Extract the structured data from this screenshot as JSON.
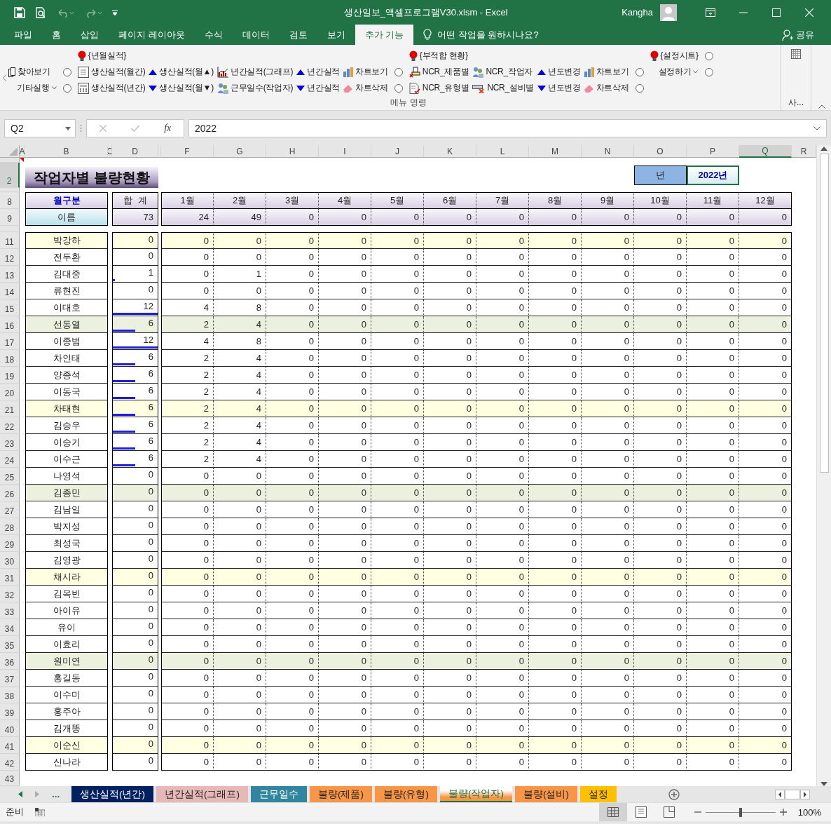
{
  "window": {
    "title": "생산일보_액셀프로그램V30.xlsm  -  Excel",
    "user": "Kangha"
  },
  "menu_tabs": [
    {
      "label": "파일",
      "selected": false
    },
    {
      "label": "홈",
      "selected": false
    },
    {
      "label": "삽입",
      "selected": false
    },
    {
      "label": "페이지 레이아웃",
      "selected": false
    },
    {
      "label": "수식",
      "selected": false
    },
    {
      "label": "데이터",
      "selected": false
    },
    {
      "label": "검토",
      "selected": false
    },
    {
      "label": "보기",
      "selected": false
    },
    {
      "label": "추가 기능",
      "selected": true
    }
  ],
  "tell_me": "어떤 작업을 원하시나요?",
  "share": "공유",
  "ribbon": {
    "columns": [
      {
        "cells": [
          {
            "kind": "blank"
          },
          {
            "kind": "find",
            "label": "찾아보기"
          },
          {
            "kind": "menu",
            "label": "기타실행"
          }
        ]
      },
      {
        "cells": [
          {
            "kind": "blank"
          },
          {
            "kind": "radio",
            "selected": false
          },
          {
            "kind": "radio",
            "selected": false
          }
        ]
      },
      {
        "cells": [
          {
            "kind": "heading",
            "label": "{년월실적}"
          },
          {
            "kind": "form",
            "label": "생산실적(월간)"
          },
          {
            "kind": "calc",
            "label": "생산실적(년간)"
          }
        ]
      },
      {
        "cells": [
          {
            "kind": "blank"
          },
          {
            "kind": "up",
            "label": "생산실적(월▲)"
          },
          {
            "kind": "down",
            "label": "생산실적(월▼)"
          }
        ]
      },
      {
        "cells": [
          {
            "kind": "blank"
          },
          {
            "kind": "graph",
            "label": "년간실적(그래프)"
          },
          {
            "kind": "people",
            "label": "근무일수(작업자)"
          }
        ]
      },
      {
        "cells": [
          {
            "kind": "blank"
          },
          {
            "kind": "up",
            "label": "년간실적"
          },
          {
            "kind": "down",
            "label": "년간실적"
          }
        ]
      },
      {
        "cells": [
          {
            "kind": "blank"
          },
          {
            "kind": "chart",
            "label": "차트보기"
          },
          {
            "kind": "eraser",
            "label": "차트삭제"
          }
        ]
      },
      {
        "cells": [
          {
            "kind": "blank"
          },
          {
            "kind": "radio",
            "selected": false
          },
          {
            "kind": "radio",
            "selected": false
          }
        ]
      },
      {
        "cells": [
          {
            "kind": "heading",
            "label": "{부적합 현황}"
          },
          {
            "kind": "stamp",
            "label": "NCR_제품별"
          },
          {
            "kind": "doccheck",
            "label": "NCR_유형별"
          }
        ]
      },
      {
        "cells": [
          {
            "kind": "blank"
          },
          {
            "kind": "people",
            "label": "NCR_작업자"
          },
          {
            "kind": "cardcross",
            "label": "NCR_설비별"
          }
        ]
      },
      {
        "cells": [
          {
            "kind": "blank"
          },
          {
            "kind": "up",
            "label": "년도변경"
          },
          {
            "kind": "down",
            "label": "년도변경"
          }
        ]
      },
      {
        "cells": [
          {
            "kind": "blank"
          },
          {
            "kind": "chart",
            "label": "차트보기"
          },
          {
            "kind": "eraser",
            "label": "차트삭제"
          }
        ]
      },
      {
        "cells": [
          {
            "kind": "blank"
          },
          {
            "kind": "radio",
            "selected": false
          },
          {
            "kind": "radio",
            "selected": false
          }
        ]
      },
      {
        "cells": [
          {
            "kind": "heading",
            "label": "{설정시트}"
          },
          {
            "kind": "menu",
            "label": "설정하기"
          },
          {
            "kind": "blank"
          }
        ]
      },
      {
        "cells": [
          {
            "kind": "radio",
            "selected": false
          },
          {
            "kind": "radio",
            "selected": false
          },
          {
            "kind": "blank"
          }
        ]
      }
    ],
    "group_label": "메뉴 명령",
    "side_group_label": "사..."
  },
  "formula_bar": {
    "name_box": "Q2",
    "function_label": "fx",
    "value": "2022"
  },
  "columns": [
    {
      "label": "A",
      "selected": false
    },
    {
      "label": "B",
      "selected": false
    },
    {
      "label": "C",
      "selected": false
    },
    {
      "label": "D",
      "selected": false
    },
    {
      "selected": false
    },
    {
      "label": "F",
      "selected": false
    },
    {
      "label": "G",
      "selected": false
    },
    {
      "label": "H",
      "selected": false
    },
    {
      "label": "I",
      "selected": false
    },
    {
      "label": "J",
      "selected": false
    },
    {
      "label": "K",
      "selected": false
    },
    {
      "label": "L",
      "selected": false
    },
    {
      "label": "M",
      "selected": false
    },
    {
      "label": "N",
      "selected": false
    },
    {
      "label": "O",
      "selected": false
    },
    {
      "label": "P",
      "selected": false
    },
    {
      "label": "Q",
      "selected": true
    },
    {
      "label": "R",
      "selected": false
    }
  ],
  "row_headers": [
    {
      "label": "2",
      "selected": true
    },
    {
      "label": "8",
      "selected": false
    },
    {
      "label": "9",
      "selected": false
    },
    {
      "label": "11",
      "selected": false
    },
    {
      "label": "12",
      "selected": false
    },
    {
      "label": "13",
      "selected": false
    },
    {
      "label": "14",
      "selected": false
    },
    {
      "label": "15",
      "selected": false
    },
    {
      "label": "16",
      "selected": false
    },
    {
      "label": "17",
      "selected": false
    },
    {
      "label": "18",
      "selected": false
    },
    {
      "label": "19",
      "selected": false
    },
    {
      "label": "20",
      "selected": false
    },
    {
      "label": "21",
      "selected": false
    },
    {
      "label": "22",
      "selected": false
    },
    {
      "label": "23",
      "selected": false
    },
    {
      "label": "24",
      "selected": false
    },
    {
      "label": "25",
      "selected": false
    },
    {
      "label": "26",
      "selected": false
    },
    {
      "label": "27",
      "selected": false
    },
    {
      "label": "28",
      "selected": false
    },
    {
      "label": "29",
      "selected": false
    },
    {
      "label": "30",
      "selected": false
    },
    {
      "label": "31",
      "selected": false
    },
    {
      "label": "32",
      "selected": false
    },
    {
      "label": "33",
      "selected": false
    },
    {
      "label": "34",
      "selected": false
    },
    {
      "label": "35",
      "selected": false
    },
    {
      "label": "36",
      "selected": false
    },
    {
      "label": "37",
      "selected": false
    },
    {
      "label": "38",
      "selected": false
    },
    {
      "label": "39",
      "selected": false
    },
    {
      "label": "40",
      "selected": false
    },
    {
      "label": "41",
      "selected": false
    },
    {
      "label": "42",
      "selected": false
    },
    {
      "label": "43",
      "selected": false
    }
  ],
  "sheet": {
    "title": "작업자별 불량현황",
    "year_label": "년",
    "year_value": "2022년",
    "year_selected": true,
    "header": {
      "label": "월구분",
      "total": "합  계",
      "months": [
        "1월",
        "2월",
        "3월",
        "4월",
        "5월",
        "6월",
        "7월",
        "8월",
        "9월",
        "10월",
        "11월",
        "12월"
      ]
    },
    "summary": {
      "label": "이름",
      "total": "73",
      "months": [
        "24",
        "49",
        "0",
        "0",
        "0",
        "0",
        "0",
        "0",
        "0",
        "0",
        "0",
        "0"
      ]
    },
    "rows": [
      {
        "name": "박강하",
        "color": "#ffffe1",
        "total": "0",
        "months": [
          "0",
          "0",
          "0",
          "0",
          "0",
          "0",
          "0",
          "0",
          "0",
          "0",
          "0",
          "0"
        ]
      },
      {
        "name": "전두환",
        "color": "#ffffff",
        "total": "0",
        "months": [
          "0",
          "0",
          "0",
          "0",
          "0",
          "0",
          "0",
          "0",
          "0",
          "0",
          "0",
          "0"
        ]
      },
      {
        "name": "김대중",
        "color": "#ffffff",
        "total": "1",
        "level": 0.05,
        "months": [
          "0",
          "1",
          "0",
          "0",
          "0",
          "0",
          "0",
          "0",
          "0",
          "0",
          "0",
          "0"
        ]
      },
      {
        "name": "류현진",
        "color": "#ffffff",
        "total": "0",
        "months": [
          "0",
          "0",
          "0",
          "0",
          "0",
          "0",
          "0",
          "0",
          "0",
          "0",
          "0",
          "0"
        ]
      },
      {
        "name": "이대호",
        "color": "#ffffff",
        "total": "12",
        "level": 1,
        "months": [
          "4",
          "8",
          "0",
          "0",
          "0",
          "0",
          "0",
          "0",
          "0",
          "0",
          "0",
          "0"
        ]
      },
      {
        "name": "선동열",
        "color": "#ebf1de",
        "total": "6",
        "level": 0.5,
        "months": [
          "2",
          "4",
          "0",
          "0",
          "0",
          "0",
          "0",
          "0",
          "0",
          "0",
          "0",
          "0"
        ]
      },
      {
        "name": "이종범",
        "color": "#ffffff",
        "total": "12",
        "level": 1,
        "months": [
          "4",
          "8",
          "0",
          "0",
          "0",
          "0",
          "0",
          "0",
          "0",
          "0",
          "0",
          "0"
        ]
      },
      {
        "name": "차인태",
        "color": "#ffffff",
        "total": "6",
        "level": 0.5,
        "months": [
          "2",
          "4",
          "0",
          "0",
          "0",
          "0",
          "0",
          "0",
          "0",
          "0",
          "0",
          "0"
        ]
      },
      {
        "name": "양종석",
        "color": "#ffffff",
        "total": "6",
        "level": 0.5,
        "months": [
          "2",
          "4",
          "0",
          "0",
          "0",
          "0",
          "0",
          "0",
          "0",
          "0",
          "0",
          "0"
        ]
      },
      {
        "name": "이동국",
        "color": "#ffffff",
        "total": "6",
        "level": 0.5,
        "months": [
          "2",
          "4",
          "0",
          "0",
          "0",
          "0",
          "0",
          "0",
          "0",
          "0",
          "0",
          "0"
        ]
      },
      {
        "name": "차태현",
        "color": "#ffffe1",
        "total": "6",
        "level": 0.5,
        "months": [
          "2",
          "4",
          "0",
          "0",
          "0",
          "0",
          "0",
          "0",
          "0",
          "0",
          "0",
          "0"
        ]
      },
      {
        "name": "김승우",
        "color": "#ffffff",
        "total": "6",
        "level": 0.5,
        "months": [
          "2",
          "4",
          "0",
          "0",
          "0",
          "0",
          "0",
          "0",
          "0",
          "0",
          "0",
          "0"
        ]
      },
      {
        "name": "이승기",
        "color": "#ffffff",
        "total": "6",
        "level": 0.5,
        "months": [
          "2",
          "4",
          "0",
          "0",
          "0",
          "0",
          "0",
          "0",
          "0",
          "0",
          "0",
          "0"
        ]
      },
      {
        "name": "이수근",
        "color": "#ffffff",
        "total": "6",
        "level": 0.5,
        "months": [
          "2",
          "4",
          "0",
          "0",
          "0",
          "0",
          "0",
          "0",
          "0",
          "0",
          "0",
          "0"
        ]
      },
      {
        "name": "나영석",
        "color": "#ffffff",
        "total": "0",
        "months": [
          "0",
          "0",
          "0",
          "0",
          "0",
          "0",
          "0",
          "0",
          "0",
          "0",
          "0",
          "0"
        ]
      },
      {
        "name": "김종민",
        "color": "#ebf1de",
        "total": "0",
        "months": [
          "0",
          "0",
          "0",
          "0",
          "0",
          "0",
          "0",
          "0",
          "0",
          "0",
          "0",
          "0"
        ]
      },
      {
        "name": "김남일",
        "color": "#ffffff",
        "total": "0",
        "months": [
          "0",
          "0",
          "0",
          "0",
          "0",
          "0",
          "0",
          "0",
          "0",
          "0",
          "0",
          "0"
        ]
      },
      {
        "name": "박지성",
        "color": "#ffffff",
        "total": "0",
        "months": [
          "0",
          "0",
          "0",
          "0",
          "0",
          "0",
          "0",
          "0",
          "0",
          "0",
          "0",
          "0"
        ]
      },
      {
        "name": "최성국",
        "color": "#ffffff",
        "total": "0",
        "months": [
          "0",
          "0",
          "0",
          "0",
          "0",
          "0",
          "0",
          "0",
          "0",
          "0",
          "0",
          "0"
        ]
      },
      {
        "name": "김영광",
        "color": "#ffffff",
        "total": "0",
        "months": [
          "0",
          "0",
          "0",
          "0",
          "0",
          "0",
          "0",
          "0",
          "0",
          "0",
          "0",
          "0"
        ]
      },
      {
        "name": "채시라",
        "color": "#ffffe1",
        "total": "0",
        "months": [
          "0",
          "0",
          "0",
          "0",
          "0",
          "0",
          "0",
          "0",
          "0",
          "0",
          "0",
          "0"
        ]
      },
      {
        "name": "김옥빈",
        "color": "#ffffff",
        "total": "0",
        "months": [
          "0",
          "0",
          "0",
          "0",
          "0",
          "0",
          "0",
          "0",
          "0",
          "0",
          "0",
          "0"
        ]
      },
      {
        "name": "아이유",
        "color": "#ffffff",
        "total": "0",
        "months": [
          "0",
          "0",
          "0",
          "0",
          "0",
          "0",
          "0",
          "0",
          "0",
          "0",
          "0",
          "0"
        ]
      },
      {
        "name": "유이",
        "color": "#ffffff",
        "total": "0",
        "months": [
          "0",
          "0",
          "0",
          "0",
          "0",
          "0",
          "0",
          "0",
          "0",
          "0",
          "0",
          "0"
        ]
      },
      {
        "name": "이효리",
        "color": "#ffffff",
        "total": "0",
        "months": [
          "0",
          "0",
          "0",
          "0",
          "0",
          "0",
          "0",
          "0",
          "0",
          "0",
          "0",
          "0"
        ]
      },
      {
        "name": "원미연",
        "color": "#ebf1de",
        "total": "0",
        "months": [
          "0",
          "0",
          "0",
          "0",
          "0",
          "0",
          "0",
          "0",
          "0",
          "0",
          "0",
          "0"
        ]
      },
      {
        "name": "홍길동",
        "color": "#ffffff",
        "total": "0",
        "months": [
          "0",
          "0",
          "0",
          "0",
          "0",
          "0",
          "0",
          "0",
          "0",
          "0",
          "0",
          "0"
        ]
      },
      {
        "name": "이수미",
        "color": "#ffffff",
        "total": "0",
        "months": [
          "0",
          "0",
          "0",
          "0",
          "0",
          "0",
          "0",
          "0",
          "0",
          "0",
          "0",
          "0"
        ]
      },
      {
        "name": "홍주아",
        "color": "#ffffff",
        "total": "0",
        "months": [
          "0",
          "0",
          "0",
          "0",
          "0",
          "0",
          "0",
          "0",
          "0",
          "0",
          "0",
          "0"
        ]
      },
      {
        "name": "김개똥",
        "color": "#ffffff",
        "total": "0",
        "months": [
          "0",
          "0",
          "0",
          "0",
          "0",
          "0",
          "0",
          "0",
          "0",
          "0",
          "0",
          "0"
        ]
      },
      {
        "name": "이순신",
        "color": "#ffffe1",
        "total": "0",
        "months": [
          "0",
          "0",
          "0",
          "0",
          "0",
          "0",
          "0",
          "0",
          "0",
          "0",
          "0",
          "0"
        ]
      },
      {
        "name": "신나라",
        "color": "#ffffff",
        "total": "0",
        "months": [
          "0",
          "0",
          "0",
          "0",
          "0",
          "0",
          "0",
          "0",
          "0",
          "0",
          "0",
          "0"
        ]
      }
    ]
  },
  "sheet_tabs": {
    "more": "...",
    "tabs": [
      {
        "label": "생산실적(년간)",
        "color": "#002060",
        "selected": false
      },
      {
        "label": "년간실적(그래프)",
        "color": "#e6b8b7",
        "selected": false
      },
      {
        "label": "근무일수",
        "color": "#31859c",
        "selected": false
      },
      {
        "label": "불량(제품)",
        "color": "#f79646",
        "selected": false
      },
      {
        "label": "불량(유형)",
        "color": "#f79646",
        "selected": false
      },
      {
        "label": "불량(작업자)",
        "color": "#f79646",
        "selected": true
      },
      {
        "label": "불량(설비)",
        "color": "#f79646",
        "selected": false
      },
      {
        "label": "설정",
        "color": "#ffc000",
        "selected": false
      }
    ]
  },
  "status_bar": {
    "status": "준비",
    "zoom": "100%",
    "zoom_slider": {
      "level": 0.5
    },
    "views": [
      {
        "kind": "normal",
        "selected": true
      },
      {
        "kind": "layout",
        "selected": false
      },
      {
        "kind": "break",
        "selected": false
      }
    ]
  }
}
